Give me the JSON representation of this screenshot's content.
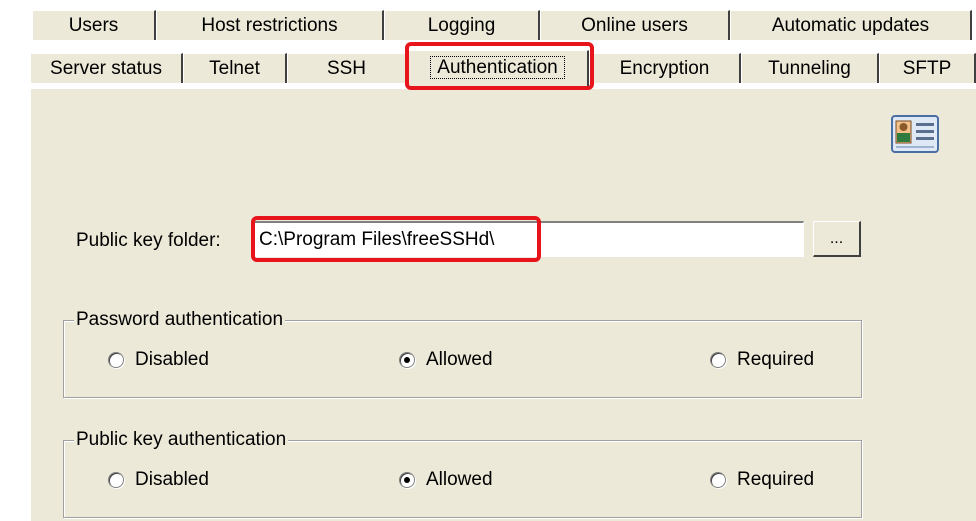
{
  "tabs_row_back": [
    {
      "label": "Users"
    },
    {
      "label": "Host restrictions"
    },
    {
      "label": "Logging"
    },
    {
      "label": "Online users"
    },
    {
      "label": "Automatic updates"
    }
  ],
  "tabs_row_front": [
    {
      "label": "Server status"
    },
    {
      "label": "Telnet"
    },
    {
      "label": "SSH"
    },
    {
      "label": "Authentication",
      "selected": true
    },
    {
      "label": "Encryption"
    },
    {
      "label": "Tunneling"
    },
    {
      "label": "SFTP"
    }
  ],
  "icons": {
    "card": "id-card-icon"
  },
  "public_key_folder": {
    "label": "Public key folder:",
    "value": "C:\\Program Files\\freeSSHd\\",
    "browse_label": "..."
  },
  "password_auth": {
    "title": "Password authentication",
    "options": [
      "Disabled",
      "Allowed",
      "Required"
    ],
    "selected": "Allowed"
  },
  "pubkey_auth": {
    "title": "Public key authentication",
    "options": [
      "Disabled",
      "Allowed",
      "Required"
    ],
    "selected": "Allowed"
  },
  "colors": {
    "highlight": "#e8141c",
    "panel": "#ece9d8"
  }
}
